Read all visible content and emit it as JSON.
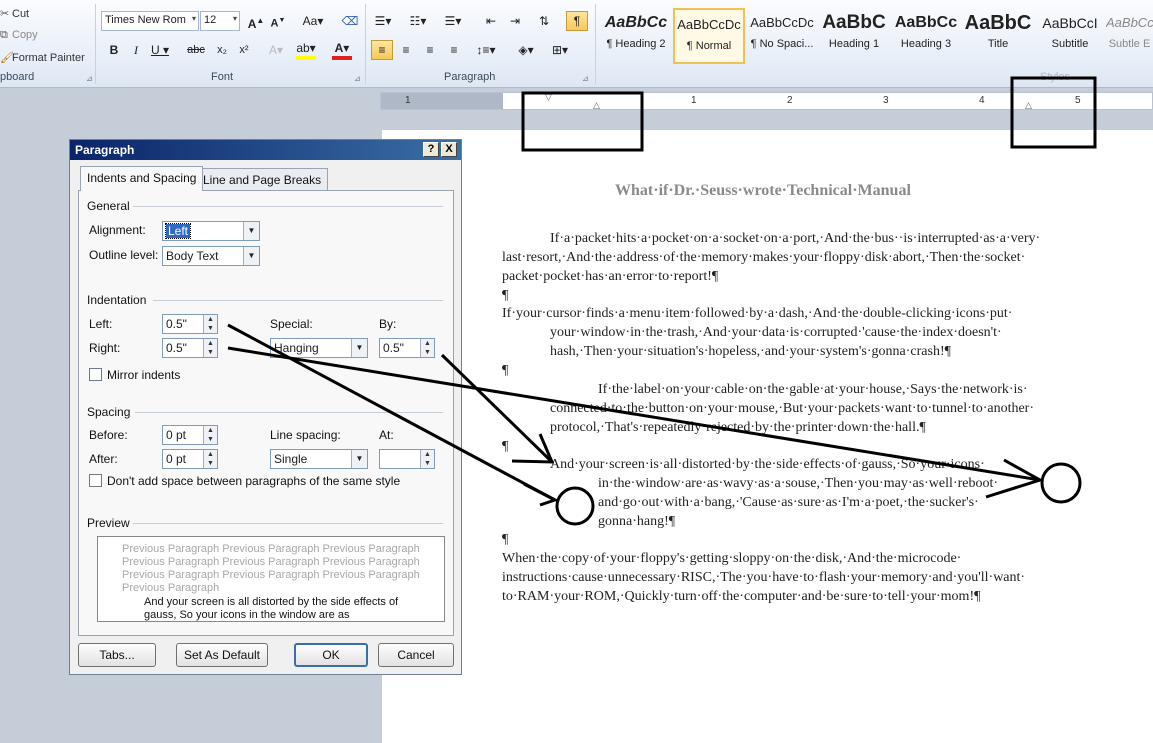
{
  "ribbon": {
    "clipboard": {
      "cut": "Cut",
      "copy": "Copy",
      "format_painter": "Format Painter",
      "group_label": "pboard"
    },
    "font": {
      "name": "Times New Rom",
      "size": "12",
      "group_label": "Font"
    },
    "paragraph": {
      "group_label": "Paragraph"
    },
    "styles": {
      "group_label": "Styles",
      "tiles": [
        {
          "sample": "AaBbCc",
          "name": "¶ Heading 2"
        },
        {
          "sample": "AaBbCcDc",
          "name": "¶ Normal"
        },
        {
          "sample": "AaBbCcDc",
          "name": "¶ No Spaci..."
        },
        {
          "sample": "AaBbC",
          "name": "Heading 1"
        },
        {
          "sample": "AaBbCc",
          "name": "Heading 3"
        },
        {
          "sample": "AaBbC",
          "name": "Title"
        },
        {
          "sample": "AaBbCcI",
          "name": "Subtitle"
        },
        {
          "sample": "AaBbCc",
          "name": "Subtle E"
        }
      ]
    }
  },
  "ruler": {
    "numbers": [
      "1",
      "1",
      "2",
      "3",
      "4",
      "5"
    ]
  },
  "document": {
    "title": "What·if·Dr.·Seuss·wrote·Technical·Manual",
    "paragraphs": [
      [
        "If·a·packet·hits·a·pocket·on·a·socket·on·a·port,·And·the·bus··is·interrupted·as·a·very·",
        "last·resort,·And·the·address·of·the·memory·makes·your·floppy·disk·abort,·Then·the·socket·",
        "packet·pocket·has·an·error·to·report!¶"
      ],
      [
        "¶"
      ],
      [
        "If·your·cursor·finds·a·menu·item·followed·by·a·dash,·And·the·double-clicking·icons·put·",
        "your·window·in·the·trash,·And·your·data·is·corrupted·'cause·the·index·doesn't·",
        "hash,·Then·your·situation's·hopeless,·and·your·system's·gonna·crash!¶"
      ],
      [
        "¶"
      ],
      [
        "If·the·label·on·your·cable·on·the·gable·at·your·house,·Says·the·network·is·",
        "connected·to·the·button·on·your·mouse,·But·your·packets·want·to·tunnel·to·another·",
        "protocol,·That's·repeatedly·rejected·by·the·printer·down·the·hall.¶"
      ],
      [
        "¶"
      ],
      [
        "And·your·screen·is·all·distorted·by·the·side·effects·of·gauss,·So·your·icons·",
        "in·the·window·are·as·wavy·as·a·souse,·Then·you·may·as·well·reboot·",
        "and·go·out·with·a·bang,·'Cause·as·sure·as·I'm·a·poet,·the·sucker's·",
        "gonna·hang!¶"
      ],
      [
        "¶"
      ],
      [
        "When·the·copy·of·your·floppy's·getting·sloppy·on·the·disk,·And·the·microcode·",
        "instructions·cause·unnecessary·RISC,·The·you·have·to·flash·your·memory·and·you'll·want·",
        "to·RAM·your·ROM,·Quickly·turn·off·the·computer·and·be·sure·to·tell·your·mom!¶"
      ]
    ]
  },
  "dialog": {
    "title": "Paragraph",
    "help_btn": "?",
    "close_btn": "X",
    "tabs": [
      "Indents and Spacing",
      "Line and Page Breaks"
    ],
    "general": {
      "section": "General",
      "alignment_label": "Alignment:",
      "alignment_value": "Left",
      "outline_label": "Outline level:",
      "outline_value": "Body Text"
    },
    "indentation": {
      "section": "Indentation",
      "left_label": "Left:",
      "left_value": "0.5\"",
      "right_label": "Right:",
      "right_value": "0.5\"",
      "special_label": "Special:",
      "special_value": "Hanging",
      "by_label": "By:",
      "by_value": "0.5\"",
      "mirror_label": "Mirror indents"
    },
    "spacing": {
      "section": "Spacing",
      "before_label": "Before:",
      "before_value": "0 pt",
      "after_label": "After:",
      "after_value": "0 pt",
      "line_label": "Line spacing:",
      "line_value": "Single",
      "at_label": "At:",
      "at_value": "",
      "dont_add_label": "Don't add space between paragraphs of the same style"
    },
    "preview": {
      "section": "Preview",
      "previous": "Previous Paragraph Previous Paragraph Previous Paragraph Previous Paragraph Previous Paragraph Previous Paragraph Previous Paragraph Previous Paragraph Previous Paragraph Previous Paragraph",
      "current": "And your screen is all distorted by the side effects of gauss, So your icons in the window are as"
    },
    "buttons": {
      "tabs": "Tabs...",
      "default": "Set As Default",
      "ok": "OK",
      "cancel": "Cancel"
    }
  },
  "colors": {
    "ribbon_bg": "#e4ecf7",
    "title_bar": "#0a246a",
    "highlight": "#f7c95a",
    "annotation": "#000000"
  }
}
